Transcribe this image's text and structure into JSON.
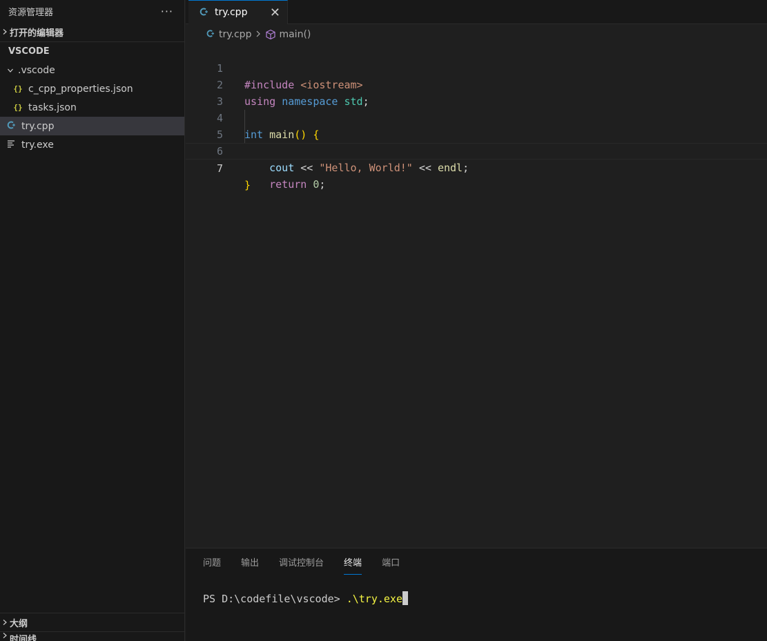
{
  "sidebar": {
    "title": "资源管理器",
    "more_icon": "ellipsis-icon",
    "open_editors_label": "打开的编辑器",
    "workspace_label": "VSCODE",
    "tree": [
      {
        "label": ".vscode",
        "icon": "chevron-down-icon",
        "type": "folder"
      },
      {
        "label": "c_cpp_properties.json",
        "icon": "json-icon",
        "type": "file"
      },
      {
        "label": "tasks.json",
        "icon": "json-icon",
        "type": "file"
      },
      {
        "label": "try.cpp",
        "icon": "cpp-icon",
        "type": "file",
        "selected": true
      },
      {
        "label": "try.exe",
        "icon": "exe-icon",
        "type": "file"
      }
    ],
    "outline_label": "大纲",
    "timeline_label": "时间线"
  },
  "editor": {
    "tab_label": "try.cpp",
    "breadcrumb": {
      "file": "try.cpp",
      "symbol": "main()"
    },
    "lines": [
      {
        "n": "1",
        "parts": [
          "#include",
          " ",
          "<iostream>"
        ]
      },
      {
        "n": "2",
        "parts": [
          "using",
          " ",
          "namespace",
          " ",
          "std",
          ";"
        ]
      },
      {
        "n": "3",
        "parts": []
      },
      {
        "n": "4",
        "parts": [
          "int",
          " ",
          "main",
          "()",
          " ",
          "{"
        ]
      },
      {
        "n": "5",
        "parts": [
          "    ",
          "cout",
          " << ",
          "\"Hello, World!\"",
          " << ",
          "endl",
          ";"
        ]
      },
      {
        "n": "6",
        "parts": [
          "    ",
          "return",
          " ",
          "0",
          ";"
        ]
      },
      {
        "n": "7",
        "parts": [
          "}"
        ]
      }
    ]
  },
  "panel": {
    "tabs": [
      "问题",
      "输出",
      "调试控制台",
      "终端",
      "端口"
    ],
    "active_tab": "终端",
    "terminal": {
      "prompt": "PS D:\\codefile\\vscode> ",
      "command": ".\\try.exe"
    }
  },
  "colors": {
    "accent": "#0078d4",
    "background": "#1f1f1f",
    "sidebar_background": "#181818",
    "selection": "#37373d"
  }
}
